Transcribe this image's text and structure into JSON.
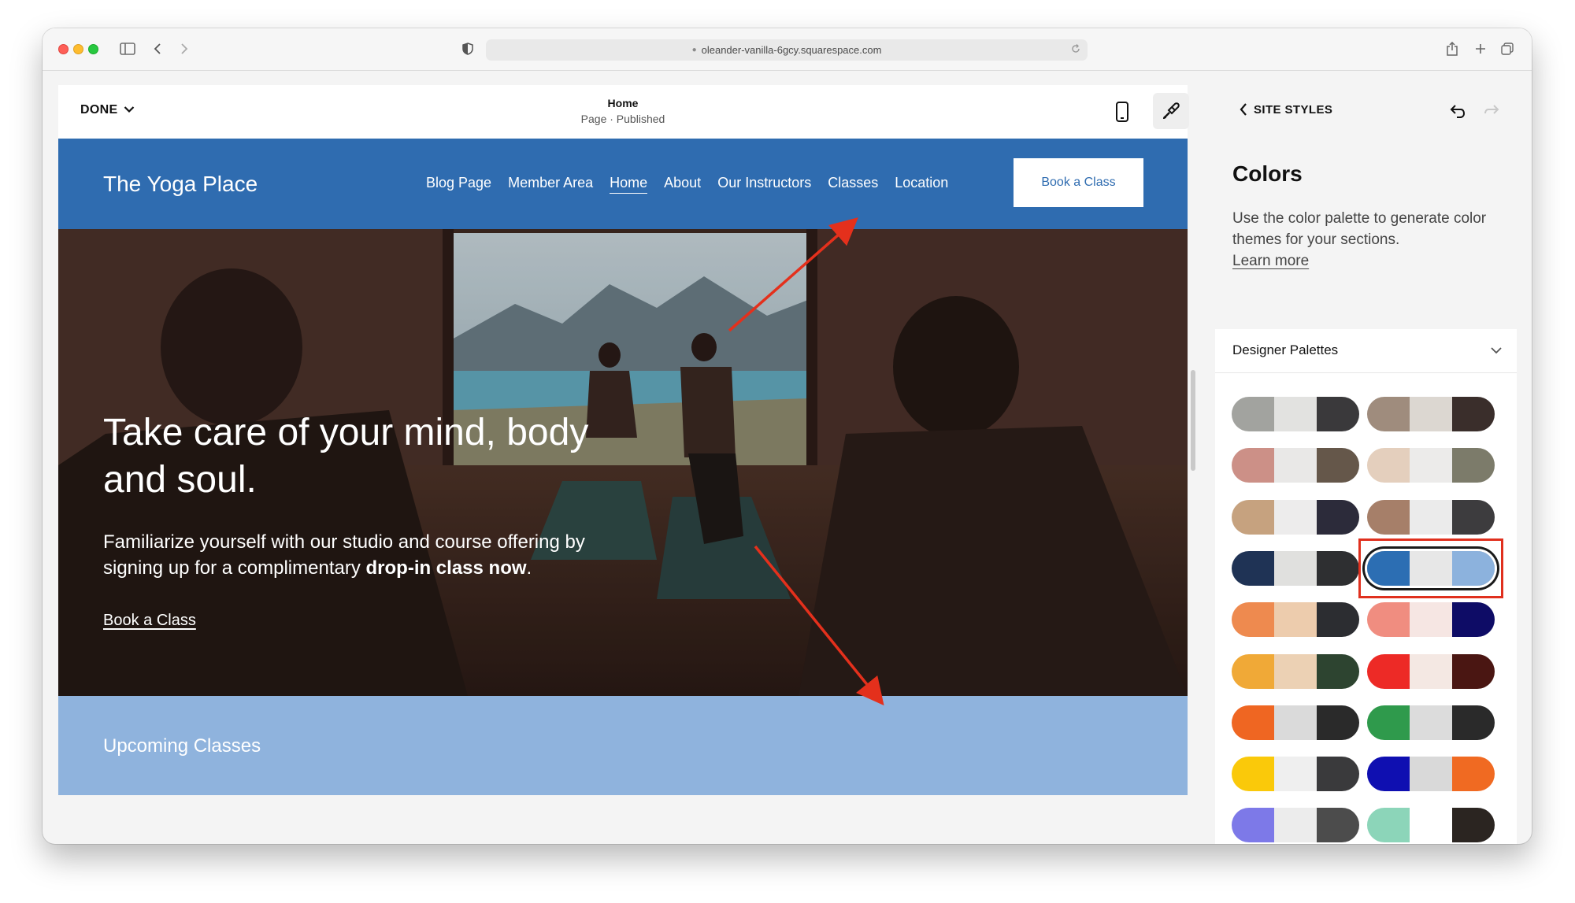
{
  "browser": {
    "url": "oleander-vanilla-6gcy.squarespace.com"
  },
  "editor": {
    "done_label": "DONE",
    "page_title": "Home",
    "page_status": "Page · Published"
  },
  "site": {
    "title": "The Yoga Place",
    "nav": [
      "Blog Page",
      "Member Area",
      "Home",
      "About",
      "Our Instructors",
      "Classes",
      "Location"
    ],
    "active_nav": "Home",
    "cta": "Book a Class",
    "hero_heading": "Take care of your mind, body and soul.",
    "hero_body_plain": "Familiarize yourself with our studio and course offering by signing up for a complimentary ",
    "hero_body_bold": "drop-in class now",
    "hero_body_end": ".",
    "hero_link": "Book a Class",
    "upcoming": "Upcoming Classes",
    "colors": {
      "nav_bg": "#2f6cb0",
      "section_bg": "#8fb3dd"
    }
  },
  "panel": {
    "back_label": "SITE STYLES",
    "heading": "Colors",
    "description": "Use the color palette to generate color themes for your sections.",
    "learn_more": "Learn more",
    "dropdown_label": "Designer Palettes",
    "selected_palette_index": 7,
    "palettes": [
      [
        "#a2a39f",
        "#e2e2e0",
        "#3a393b"
      ],
      [
        "#9f8c7d",
        "#dcd7d1",
        "#3a2e2b"
      ],
      [
        "#cc9087",
        "#e9e8e7",
        "#65574a"
      ],
      [
        "#e4cfbd",
        "#ecebea",
        "#7c7b6a"
      ],
      [
        "#c6a27f",
        "#edecec",
        "#2c2b3a"
      ],
      [
        "#a67f69",
        "#ebebeb",
        "#3d3c3e"
      ],
      [
        "#1f3355",
        "#e0e0de",
        "#2e2f31"
      ],
      [
        "#2c6eb3",
        "#e7e7e7",
        "#8cb2dd"
      ],
      [
        "#ee8a4f",
        "#edccad",
        "#2c2d31"
      ],
      [
        "#f08d80",
        "#f6e6e3",
        "#0e0c66"
      ],
      [
        "#f0a937",
        "#ecd1b4",
        "#2d4430"
      ],
      [
        "#ed2a26",
        "#f4e8e3",
        "#4a1612"
      ],
      [
        "#ef6622",
        "#dadada",
        "#2a2a2a"
      ],
      [
        "#2f9a4c",
        "#dcdcdc",
        "#2a2a2a"
      ],
      [
        "#fac90a",
        "#efefef",
        "#3a3a3c"
      ],
      [
        "#0f0fb1",
        "#d9d9d9",
        "#f06a22"
      ],
      [
        "#7d79e8",
        "#ececec",
        "#4c4c4c"
      ],
      [
        "#8cd5b9",
        "#ffffff",
        "#2b2521"
      ]
    ]
  }
}
